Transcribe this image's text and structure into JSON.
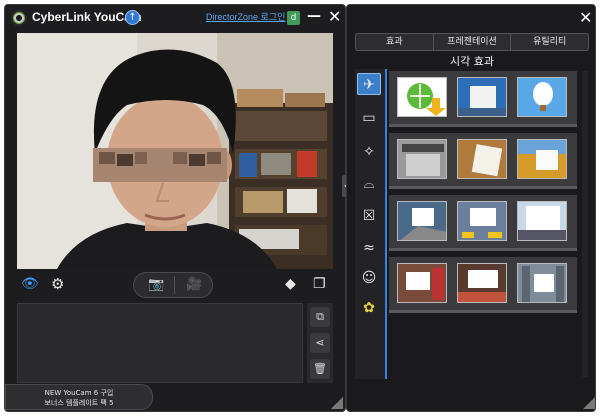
{
  "window": {
    "app_title": "CyberLink YouCam",
    "director_zone_link": "DirectorZone 로그인",
    "promo_line1": "NEW YouCam 6 구입",
    "promo_line2": "보너스 템플레이트 팩 5"
  },
  "panel": {
    "tabs": [
      "효과",
      "프레젠테이션",
      "유틸리티"
    ],
    "active_tab": 0,
    "category_title": "시각 효과"
  },
  "icons": {
    "logo": "youcam-logo-icon",
    "update": "upload-arrow-icon",
    "minimize": "minimize-icon",
    "close": "close-icon",
    "eye": "eye-icon",
    "settings": "gear-icon",
    "camera": "camera-icon",
    "video": "video-camera-icon",
    "eraser": "eraser-icon",
    "fullscreen": "resize-window-icon"
  },
  "colors": {
    "accent": "#2e86e0",
    "window_bg": "#1d1d1f"
  }
}
